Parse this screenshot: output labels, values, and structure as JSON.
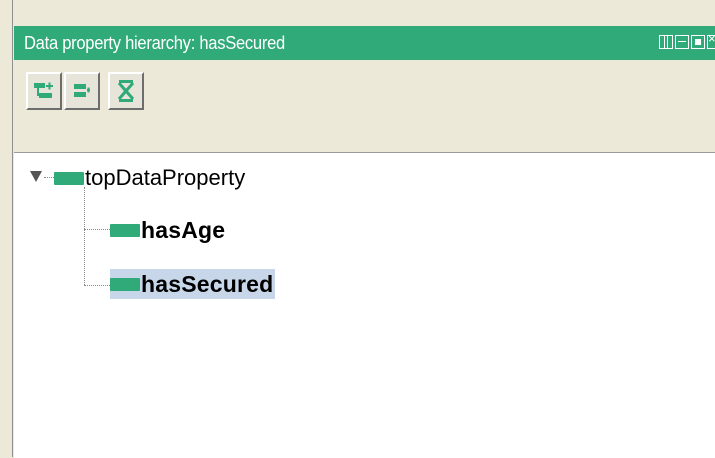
{
  "panel": {
    "title": "Data property hierarchy: hasSecured",
    "accent_color": "#2faa78",
    "window_controls": [
      "split-view-icon",
      "minimize-icon",
      "maximize-icon",
      "close-icon"
    ]
  },
  "toolbar": {
    "buttons": [
      {
        "name": "add-subproperty",
        "icon": "add-subproperty-icon"
      },
      {
        "name": "add-sibling-property",
        "icon": "add-sibling-property-icon"
      },
      {
        "name": "delete-property",
        "icon": "delete-property-icon"
      }
    ]
  },
  "tree": {
    "root": {
      "label": "topDataProperty",
      "expanded": true,
      "children": [
        {
          "label": "hasAge",
          "selected": false
        },
        {
          "label": "hasSecured",
          "selected": true
        }
      ]
    }
  }
}
